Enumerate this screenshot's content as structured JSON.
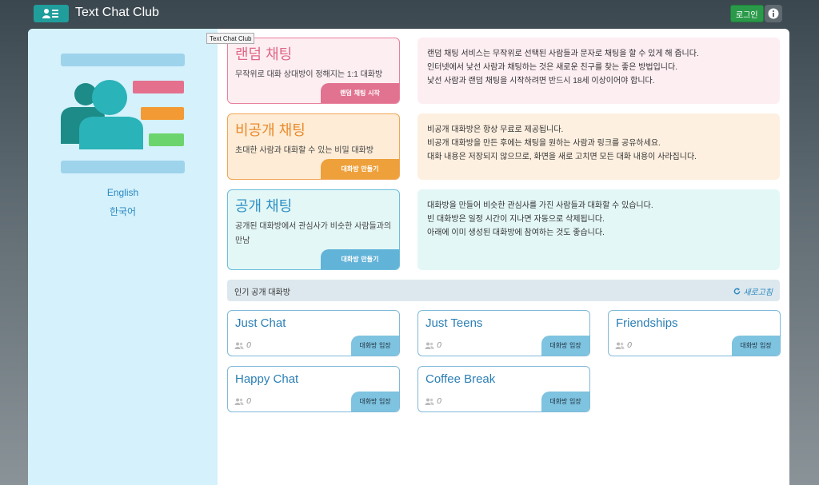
{
  "app": {
    "title": "Text Chat Club",
    "login_label": "로그인",
    "tooltip": "Text Chat Club"
  },
  "colors": {
    "random": "#e76f8e",
    "private": "#f0a040",
    "public": "#5cb3d8",
    "random_bg": "#fdeef2",
    "private_bg": "#fef0e0",
    "public_bg": "#e3f7f6"
  },
  "sidebar": {
    "languages": [
      "English",
      "한국어"
    ]
  },
  "features": [
    {
      "key": "random",
      "title": "랜덤 채팅",
      "subtitle": "무작위로 대화 상대방이 정해지는 1:1 대화방",
      "button": "랜덤 채팅 시작",
      "description": [
        "랜덤 채팅 서비스는 무작위로 선택된 사람들과 문자로 채팅을 할 수 있게 해 줍니다.",
        "인터넷에서 낯선 사람과 채팅하는 것은 새로운 친구를 찾는 좋은 방법입니다.",
        "낯선 사람과 랜덤 채팅을 시작하려면 반드시 18세 이상이어야 합니다."
      ]
    },
    {
      "key": "private",
      "title": "비공개 채팅",
      "subtitle": "초대한 사람과 대화할 수 있는 비밀 대화방",
      "button": "대화방 만들기",
      "description": [
        "비공개 대화방은 항상 무료로 제공됩니다.",
        "비공개 대화방을 만든 후에는 채팅을 원하는 사람과 링크를 공유하세요.",
        "대화 내용은 저장되지 않으므로, 화면을 새로 고치면 모든 대화 내용이 사라집니다."
      ]
    },
    {
      "key": "public",
      "title": "공개 채팅",
      "subtitle": "공개된 대화방에서 관심사가 비슷한 사람들과의 만남",
      "button": "대화방 만들기",
      "description": [
        "대화방을 만들어 비슷한 관심사를 가진 사람들과 대화할 수 있습니다.",
        "빈 대화방은 일정 시간이 지나면 자동으로 삭제됩니다.",
        "아래에 이미 생성된 대화방에 참여하는 것도 좋습니다."
      ]
    }
  ],
  "popular": {
    "title": "인기 공개 대화방",
    "refresh_label": "새로고침",
    "rooms": [
      {
        "name": "Just Chat",
        "count": "0",
        "button": "대화방 입장"
      },
      {
        "name": "Just Teens",
        "count": "0",
        "button": "대화방 입장"
      },
      {
        "name": "Friendships",
        "count": "0",
        "button": "대화방 입장"
      },
      {
        "name": "Happy Chat",
        "count": "0",
        "button": "대화방 입장"
      },
      {
        "name": "Coffee Break",
        "count": "0",
        "button": "대화방 입장"
      }
    ]
  }
}
